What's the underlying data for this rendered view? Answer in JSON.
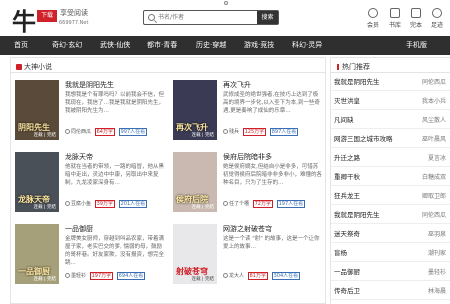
{
  "site": {
    "logo_char": "牛",
    "logo_seal": "下载",
    "logo_text": "享受阅读",
    "logo_url": "669977.Net"
  },
  "search": {
    "placeholder": "书名/作者",
    "button": "搜索"
  },
  "user_nav": [
    {
      "label": "会员",
      "icon": "member-icon"
    },
    {
      "label": "书库",
      "icon": "library-icon"
    },
    {
      "label": "完本",
      "icon": "completed-icon"
    },
    {
      "label": "足迹",
      "icon": "history-icon"
    }
  ],
  "nav": [
    "首页",
    "奇幻·玄幻",
    "武侠·仙侠",
    "都市·青春",
    "历史·穿越",
    "游戏·竞技",
    "科幻·灵异",
    "手机版"
  ],
  "section": {
    "title": "大神小说"
  },
  "books": [
    {
      "title": "我就是阴阳先生",
      "desc": "我想我是个有罪吗吗？以前我会不信，但我现在，我信了…我是我就是阴阳先生，我被阴阳先生为…",
      "author": "同伦西瓜",
      "words": "64万字",
      "readers": "997人在看",
      "cover_title": "阴阳先生",
      "cover_author": "连载 | 完结",
      "cover_color": "#5a4a3a"
    },
    {
      "title": "再次飞升",
      "desc": "武修成圣的绝世强者,在技巧上达到了极高的境界一步化,以入圣下为本,到一些奇遇,更是奏响了成仙的乐章…",
      "author": "残兵",
      "words": "125万字",
      "readers": "897人在看",
      "cover_title": "再次飞升",
      "cover_author": "连载 | 完结",
      "cover_color": "#3a3a55"
    },
    {
      "title": "龙脉天帝",
      "desc": "他就在当者的带领，一路的暗冒，他从黑暗中走出，灵边中中康，另取出中来复制，九龙凌家深身有…",
      "author": "豆腐小鱼",
      "words": "39万字",
      "readers": "201人在看",
      "cover_title": "龙脉天帝",
      "cover_author": "连载 | 完结",
      "cover_color": "#4a5058"
    },
    {
      "title": "侯府后院暗非多",
      "desc": "她是侯府嫡女,但结自小是非多，可惜苏初觉得侯府后院暗非非多非小，难懂的各种名目，只为了生存的…",
      "author": "任了个槽",
      "words": "72万字",
      "readers": "197人在看",
      "cover_title": "侯府后院",
      "cover_author": "连载 | 完结",
      "cover_color": "#c9b9b0"
    },
    {
      "title": "一品御厨",
      "desc": "金牌美女厨师，穿越到叫品农家，带着满屋子家，老实巴交的爹, 懦弱的母，鼓励的哥杯巷。好友家欺，没有报资，想完全跳...",
      "author": "墨轻衫",
      "words": "197万字",
      "readers": "694人在看",
      "cover_title": "一品御厨",
      "cover_author": "连载 | 完结",
      "cover_color": "#a6a07a"
    },
    {
      "title": "网游之射破苍穹",
      "desc": "这是一个读 \"射\" 的故事，这是一个让你爱上的故事…",
      "author": "龙大人",
      "words": "81万字",
      "readers": "304人在看",
      "cover_title": "射破苍穹",
      "cover_author": "连载 | 完结",
      "cover_color": "#e8e8ea"
    }
  ],
  "sidebar": {
    "title": "热门推荐",
    "items": [
      {
        "title": "我就是阴阳先生",
        "author": "同伦西瓜"
      },
      {
        "title": "灭世洪皇",
        "author": "我本小兵"
      },
      {
        "title": "凡间缺",
        "author": "风尘散人"
      },
      {
        "title": "网游三国之城市攻略",
        "author": "巫叶晨风"
      },
      {
        "title": "升迁之路",
        "author": "夏言冰"
      },
      {
        "title": "重卿干秋",
        "author": "白糖成双"
      },
      {
        "title": "狂兵龙王",
        "author": "卿取卫郎"
      },
      {
        "title": "我就是阴阳先生",
        "author": "同伦西瓜"
      },
      {
        "title": "迷天祭奇",
        "author": "巫羽泉"
      },
      {
        "title": "盲杨",
        "author": "潮刊家"
      },
      {
        "title": "一品御厨",
        "author": "墨轻衫"
      },
      {
        "title": "传奇后卫",
        "author": "林海晨"
      }
    ]
  },
  "colors": {
    "accent": "#d0202a",
    "nav_bg": "#2f2f2f",
    "link_blue": "#3a6fb5"
  }
}
